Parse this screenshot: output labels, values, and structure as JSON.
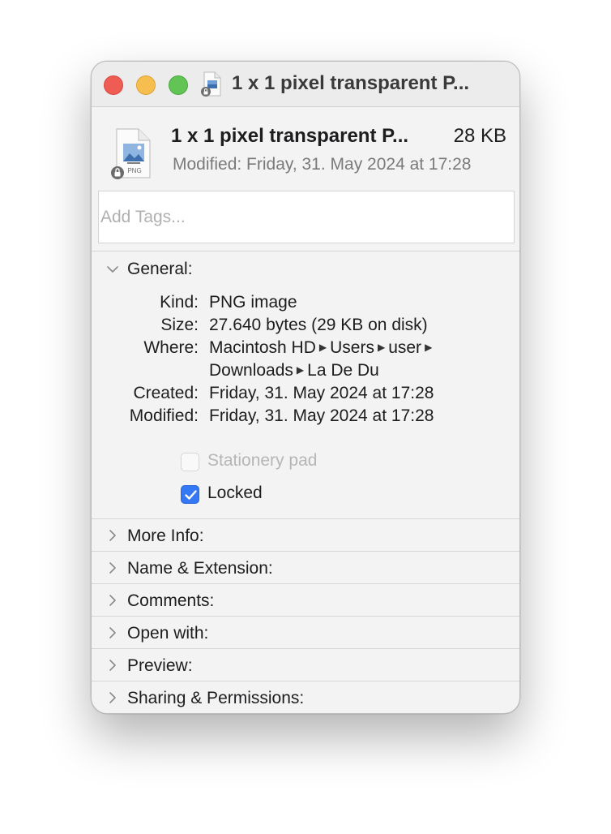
{
  "window": {
    "title": "1 x 1 pixel transparent P..."
  },
  "file": {
    "name": "1 x 1 pixel transparent P...",
    "size": "28 KB",
    "modified": "Modified: Friday, 31. May 2024 at 17:28",
    "icon_label": "PNG"
  },
  "tags": {
    "placeholder": "Add Tags..."
  },
  "general": {
    "header": "General:",
    "rows": [
      {
        "label": "Kind:",
        "value": "PNG image"
      },
      {
        "label": "Size:",
        "value": "27.640 bytes (29 KB on disk)"
      },
      {
        "label": "Where:",
        "path": [
          "Macintosh HD",
          "Users",
          "user",
          "Downloads",
          "La De Du"
        ]
      },
      {
        "label": "Created:",
        "value": "Friday, 31. May 2024 at 17:28"
      },
      {
        "label": "Modified:",
        "value": "Friday, 31. May 2024 at 17:28"
      }
    ],
    "stationery": {
      "label": "Stationery pad",
      "checked": false,
      "enabled": false
    },
    "locked": {
      "label": "Locked",
      "checked": true,
      "enabled": true
    }
  },
  "sections": [
    {
      "label": "More Info:"
    },
    {
      "label": "Name & Extension:"
    },
    {
      "label": "Comments:"
    },
    {
      "label": "Open with:"
    },
    {
      "label": "Preview:"
    },
    {
      "label": "Sharing & Permissions:"
    }
  ],
  "colors": {
    "close": "#ee5c54",
    "minimize": "#f6be4f",
    "zoom": "#61c454",
    "checkbox_accent": "#3478f6"
  },
  "icons": {
    "collapse": "chevron-down-icon",
    "expand": "chevron-right-icon",
    "lock_badge": "lock-icon",
    "path_separator": "triangle-right-icon"
  }
}
